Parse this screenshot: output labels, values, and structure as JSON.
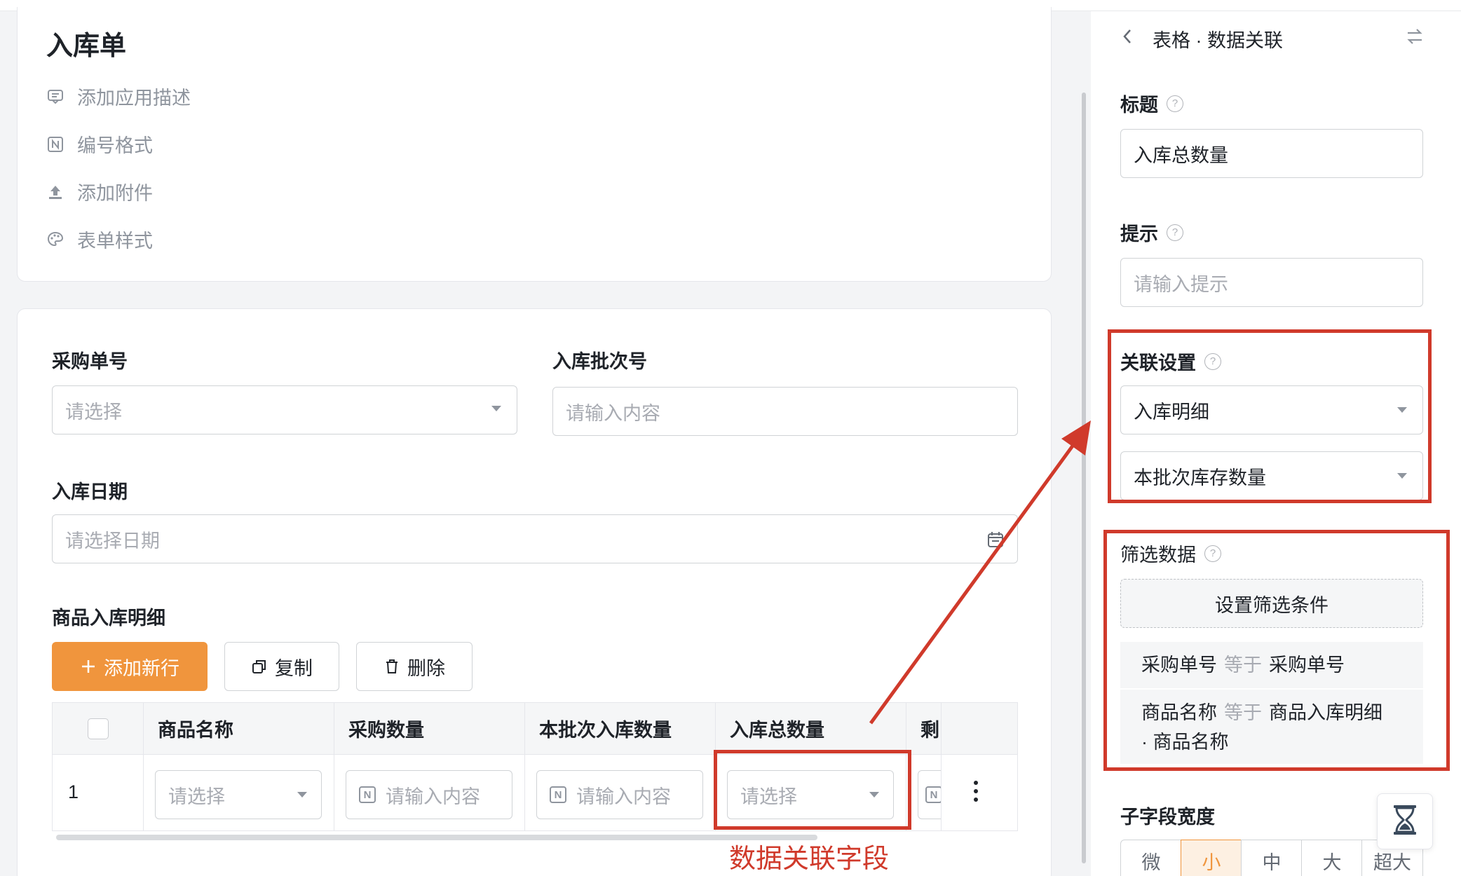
{
  "form": {
    "title": "入库单",
    "meta": {
      "add_description": "添加应用描述",
      "number_format": "编号格式",
      "add_attachment": "添加附件",
      "form_style": "表单样式"
    }
  },
  "fields": {
    "purchase_no": {
      "label": "采购单号",
      "placeholder": "请选择"
    },
    "batch_no": {
      "label": "入库批次号",
      "placeholder": "请输入内容"
    },
    "date": {
      "label": "入库日期",
      "placeholder": "请选择日期"
    },
    "detail": {
      "label": "商品入库明细"
    }
  },
  "toolbar": {
    "add_row": "添加新行",
    "copy": "复制",
    "delete": "删除"
  },
  "table": {
    "columns": [
      "商品名称",
      "采购数量",
      "本批次入库数量",
      "入库总数量",
      "剩"
    ],
    "row": {
      "index": "1",
      "product": "请选择",
      "purchase_qty": "请输入内容",
      "batch_qty": "请输入内容",
      "total_qty": "请选择"
    }
  },
  "panel": {
    "title": "表格 · 数据关联",
    "title_label": "标题",
    "title_value": "入库总数量",
    "hint_label": "提示",
    "hint_placeholder": "请输入提示",
    "link_label": "关联设置",
    "link_table": "入库明细",
    "link_field": "本批次库存数量",
    "filter_label": "筛选数据",
    "filter_button": "设置筛选条件",
    "conditions": [
      {
        "left": "采购单号",
        "op": "等于",
        "right": "采购单号"
      },
      {
        "left": "商品名称",
        "op": "等于",
        "right": "商品入库明细",
        "right2": "· 商品名称"
      }
    ],
    "width_label": "子字段宽度",
    "width_options": [
      "微",
      "小",
      "中",
      "大",
      "超大"
    ],
    "width_selected": "小"
  },
  "annotation": {
    "text": "数据关联字段"
  },
  "colors": {
    "accent": "#f0953d",
    "annotation": "#d03a2b"
  }
}
